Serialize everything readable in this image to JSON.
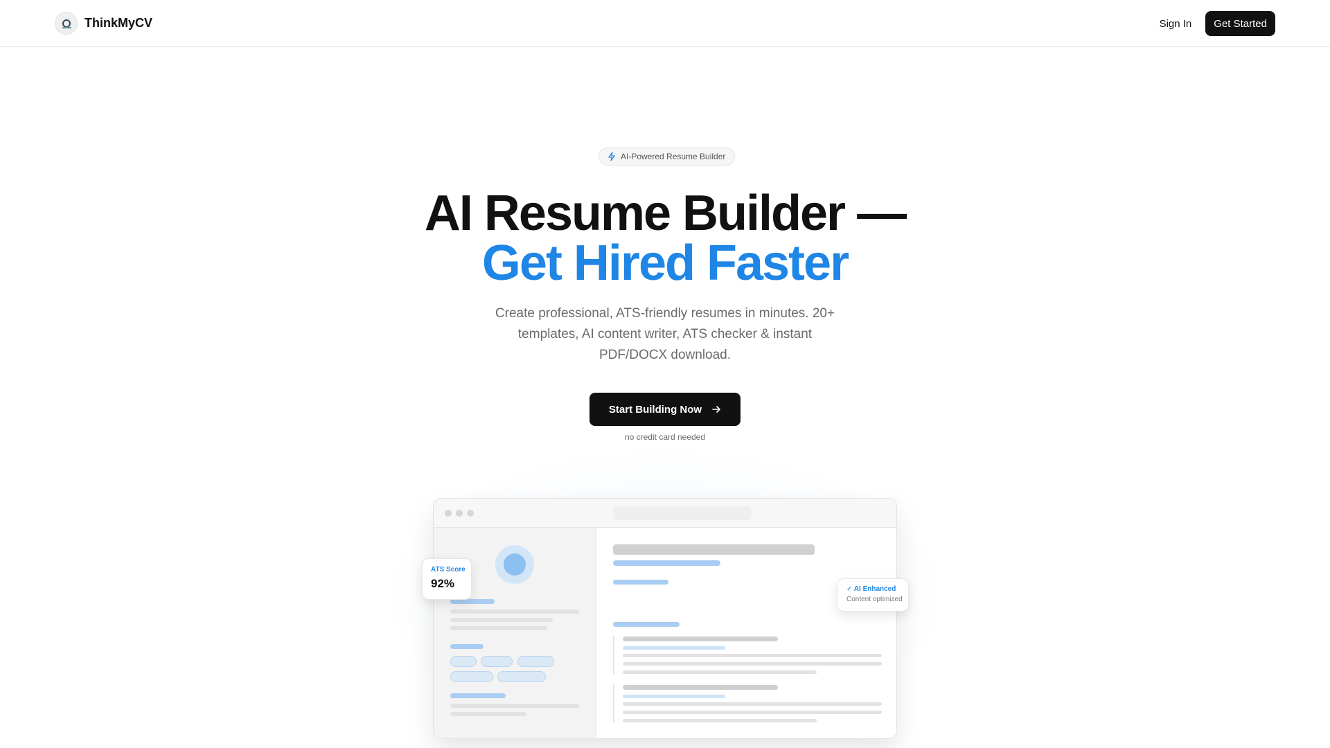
{
  "header": {
    "brand_name": "ThinkMyCV",
    "signin_label": "Sign In",
    "get_started_label": "Get Started"
  },
  "hero": {
    "badge_text": "AI-Powered Resume Builder",
    "title_line1": "AI Resume Builder —",
    "title_line2": "Get Hired Faster",
    "subtitle": "Create professional, ATS-friendly resumes in minutes. 20+ templates, AI content writer, ATS checker & instant PDF/DOCX download.",
    "cta_label": "Start Building Now",
    "cta_note": "no credit card needed"
  },
  "preview": {
    "ats_card": {
      "label": "ATS Score",
      "value": "92%"
    },
    "ai_card": {
      "label": "✓ AI Enhanced",
      "sub": "Content optimized"
    }
  },
  "colors": {
    "accent": "#1f86e6",
    "primary_button": "#111111",
    "muted_text": "#6a6a6a"
  },
  "icons": {
    "badge": "sparkle-icon",
    "cta": "arrow-right-icon",
    "logo": "thinkmycv-logo"
  }
}
